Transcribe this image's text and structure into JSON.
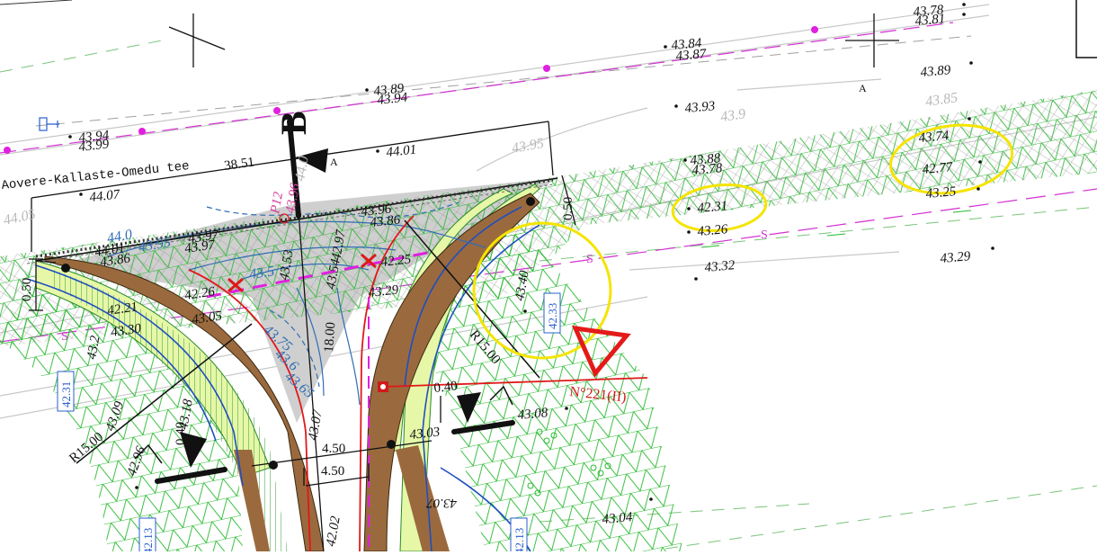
{
  "road_name": "Aovere-Kallaste-Omedu tee",
  "section_label": "B",
  "point_label": "P12",
  "point_value": "43.96",
  "sign_label": "N°221(II)",
  "dim_38": "38.51",
  "dim_18": "18.00",
  "dim_450": "4.50",
  "dim_050": "0.50",
  "dim_040": "0.40",
  "radius_label": "R15.00",
  "axis_letter": "A",
  "blue_boxes": [
    "42.31",
    "42.33",
    "42.13"
  ],
  "contour_labels": [
    "44.0",
    "43.95",
    "43.5",
    "43.75",
    "43.6",
    "43.65",
    "43.9",
    "43.85",
    "44.05",
    "43.95"
  ],
  "elevations": [
    "43.78",
    "43.81",
    "43.84",
    "43.87",
    "43.89",
    "43.89",
    "43.94",
    "43.93",
    "43.94",
    "43.99",
    "44.01",
    "44.07",
    "43.88",
    "43.78",
    "42.31",
    "43.26",
    "43.32",
    "43.29",
    "43.74",
    "42.77",
    "43.25",
    "43.96",
    "43.86",
    "43.97",
    "43.97",
    "44.01",
    "43.86",
    "42.26",
    "43.29",
    "42.25",
    "42.21",
    "43.30",
    "43.05",
    "43.2",
    "43.18",
    "43.09",
    "42.96",
    "43.40",
    "43.08",
    "43.03",
    "43.07",
    "43.04",
    "43.07",
    "42.97",
    "42.02",
    "43.53",
    "43.54",
    "43.54"
  ],
  "highlight_colors": {
    "circle": "#f5e400",
    "sign": "#e41a1a",
    "grid": "#27b92e",
    "shoulder": "#e6f7a8",
    "curb": "#9a6a3e"
  }
}
